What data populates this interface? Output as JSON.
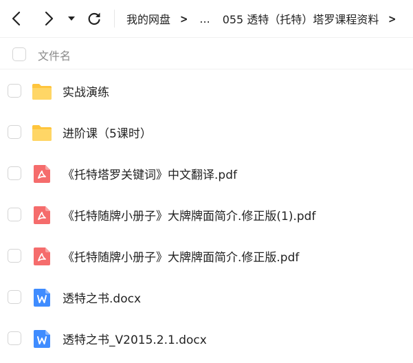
{
  "toolbar": {
    "back_icon": "chevron-left-icon",
    "forward_icon": "chevron-right-icon",
    "history_icon": "caret-down-icon",
    "refresh_icon": "refresh-icon"
  },
  "breadcrumb": {
    "root": "我的网盘",
    "separator": ">",
    "ellipsis": "...",
    "current": "055 透特（托特）塔罗课程资料",
    "trailing_separator": ">"
  },
  "list_header": {
    "column_name": "文件名"
  },
  "files": [
    {
      "name": "实战演练",
      "type": "folder"
    },
    {
      "name": "进阶课（5课时）",
      "type": "folder"
    },
    {
      "name": "《托特塔罗关键词》中文翻译.pdf",
      "type": "pdf"
    },
    {
      "name": "《托特随牌小册子》大牌牌面简介.修正版(1).pdf",
      "type": "pdf"
    },
    {
      "name": "《托特随牌小册子》大牌牌面简介.修正版.pdf",
      "type": "pdf"
    },
    {
      "name": "透特之书.docx",
      "type": "docx"
    },
    {
      "name": "透特之书_V2015.2.1.docx",
      "type": "docx"
    }
  ],
  "colors": {
    "folder": "#FFC53D",
    "pdf": "#F56C6C",
    "docx": "#3F8CFF"
  }
}
